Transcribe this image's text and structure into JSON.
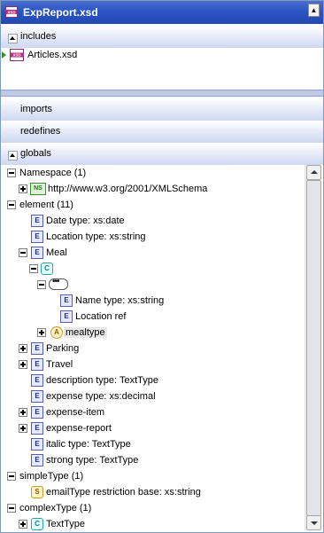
{
  "window": {
    "title": "ExpReport.xsd",
    "app_icon": "xsd-file-icon",
    "maximize_glyph": "▲"
  },
  "sections": {
    "includes": "includes",
    "imports": "imports",
    "redefines": "redefines",
    "globals": "globals"
  },
  "includes_list": [
    {
      "label": "Articles.xsd",
      "icon": "xsd-file-icon"
    }
  ],
  "tree": {
    "namespace_group": "Namespace (1)",
    "namespace_uri": "http://www.w3.org/2001/XMLSchema",
    "element_group": "element (11)",
    "date": "Date  type: xs:date",
    "location": "Location  type: xs:string",
    "meal": "Meal",
    "name": "Name  type: xs:string",
    "location_ref": "Location  ref",
    "mealtype": "mealtype",
    "parking": "Parking",
    "travel": "Travel",
    "description": "description  type: TextType",
    "expense": "expense  type: xs:decimal",
    "expense_item": "expense-item",
    "expense_report": "expense-report",
    "italic": "italic  type: TextType",
    "strong": "strong  type: TextType",
    "simpletype_group": "simpleType (1)",
    "emailtype": "emailType  restriction base: xs:string",
    "complextype_group": "complexType (1)",
    "texttype": "TextType"
  },
  "badges": {
    "element": "E",
    "complex": "C",
    "simple": "S",
    "attribute": "A",
    "namespace": "NS"
  },
  "colors": {
    "titlebar": "#2b55c4",
    "section_header": "#cfd8f2",
    "highlight": "#e9e9e9"
  }
}
